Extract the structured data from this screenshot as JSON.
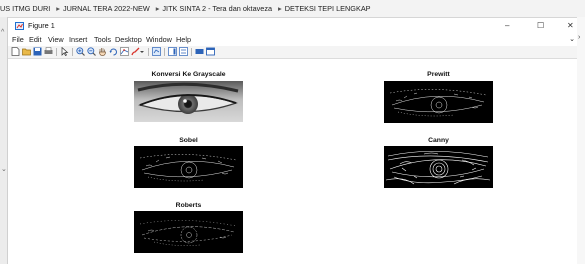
{
  "path": [
    "US ITMG DURI",
    "JURNAL TERA 2022-NEW",
    "JITK SINTA 2 - Tera dan oktaveza",
    "DETEKSI TEPI LENGKAP"
  ],
  "path_separator": "▸",
  "window": {
    "title": "Figure 1",
    "minimize": "–",
    "restore": "☐",
    "close": "✕"
  },
  "menu": [
    "File",
    "Edit",
    "View",
    "Insert",
    "Tools",
    "Desktop",
    "Window",
    "Help"
  ],
  "menu_more": "⌄",
  "plots": {
    "grayscale": "Konversi Ke Grayscale",
    "prewitt": "Prewitt",
    "sobel": "Sobel",
    "canny": "Canny",
    "roberts": "Roberts"
  },
  "colors": {
    "accent": "#1f6fd1",
    "edge": "#ffffff",
    "plot_bg": "#000000"
  }
}
